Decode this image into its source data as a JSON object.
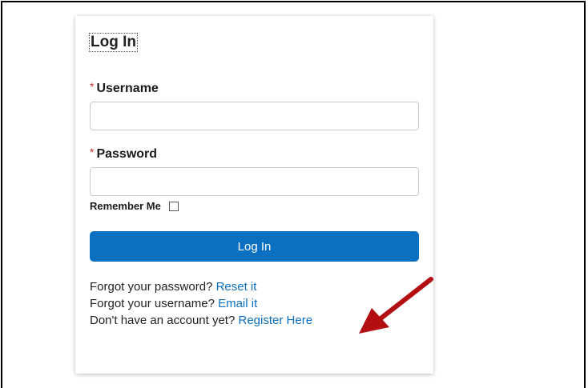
{
  "form": {
    "title": "Log In",
    "username": {
      "required_mark": "*",
      "label": "Username",
      "value": "",
      "placeholder": ""
    },
    "password": {
      "required_mark": "*",
      "label": "Password",
      "value": "",
      "placeholder": ""
    },
    "remember_me_label": "Remember Me",
    "remember_me_checked": false,
    "submit_label": "Log In"
  },
  "links": {
    "forgot_password_text": "Forgot your password? ",
    "forgot_password_link": "Reset it",
    "forgot_username_text": "Forgot your username? ",
    "forgot_username_link": "Email it",
    "register_text": "Don't have an account yet? ",
    "register_link": "Register Here"
  },
  "colors": {
    "accent": "#0b6fc2",
    "required": "#d0312d",
    "annotation_arrow": "#b30f12"
  },
  "annotation": {
    "icon": "red-arrow-icon"
  }
}
